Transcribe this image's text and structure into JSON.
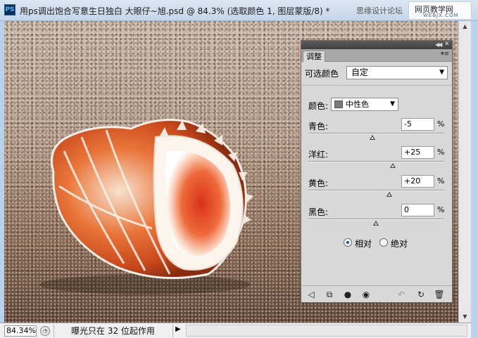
{
  "window": {
    "app_icon": "PS",
    "title": "用ps调出饱合写意生日独白 大眼仔~旭.psd @ 84.3% (选取颜色 1, 图层蒙版/8) *",
    "watermark_left": "思缘设计论坛",
    "watermark_right": "网页教学网",
    "watermark_url": "WEBJX.COM"
  },
  "status": {
    "zoom": "84.34%",
    "info": "曝光只在 32 位起作用"
  },
  "panel": {
    "tab": "调整",
    "preset_label": "可选颜色",
    "preset_value": "自定",
    "color_label": "颜色:",
    "color_value": "中性色",
    "swatch_color": "#7a7a7a",
    "sliders": [
      {
        "label": "青色:",
        "value": "-5",
        "unit": "%",
        "numeric": -5
      },
      {
        "label": "洋红:",
        "value": "+25",
        "unit": "%",
        "numeric": 25
      },
      {
        "label": "黄色:",
        "value": "+20",
        "unit": "%",
        "numeric": 20
      },
      {
        "label": "黑色:",
        "value": "0",
        "unit": "%",
        "numeric": 0
      }
    ],
    "method_relative": "相对",
    "method_absolute": "绝对",
    "method_selected": "relative"
  },
  "icons": {
    "panel_bottom": [
      "back-arrow-icon",
      "clip-layer-icon",
      "mask-icon",
      "visibility-eye-icon",
      "previous-state-icon",
      "reset-icon",
      "delete-icon"
    ]
  }
}
